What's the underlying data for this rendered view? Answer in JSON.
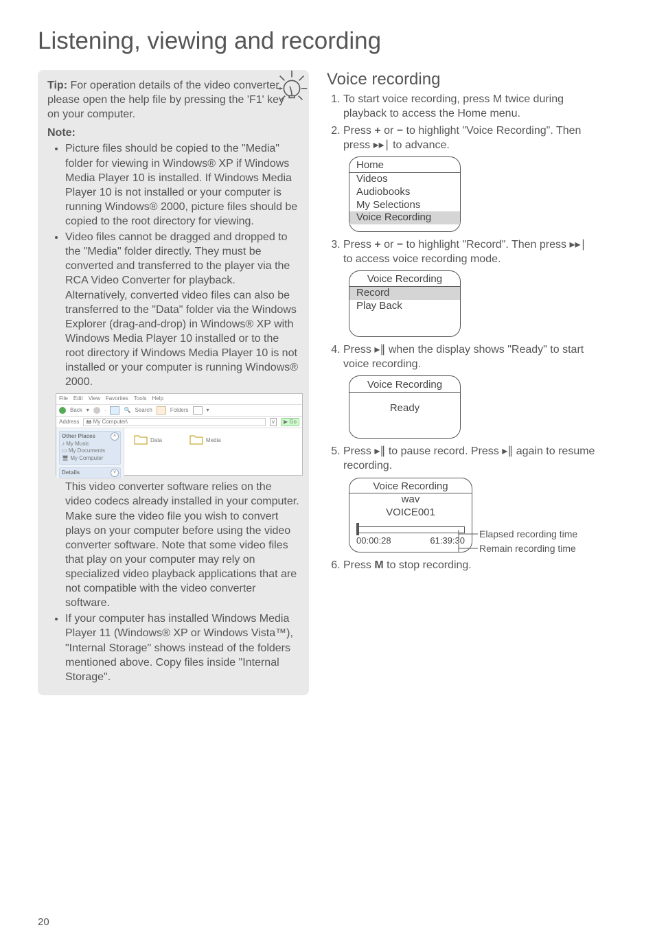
{
  "page_title": "Listening, viewing and recording",
  "tip": {
    "label": "Tip:",
    "text": " For operation details of the video converter, please open the help file by pressing the 'F1' key on your computer."
  },
  "note_label": "Note:",
  "notes": {
    "b1": "Picture files should be copied to the \"Media\" folder for viewing in Windows® XP if Windows Media Player 10 is installed. If Windows Media Player 10 is not installed or your computer is running Windows® 2000, picture files should be copied to the root directory for viewing.",
    "b2": "Video files cannot be dragged and dropped to the \"Media\" folder directly. They must be converted and transferred to the player via the RCA Video Converter for playback. Alternatively, converted video files can also be transferred  to the \"Data\" folder via the Windows Explorer (drag-and-drop) in Windows® XP with Windows Media Player 10 installed or to the root directory if Windows Media Player 10 is not installed or your computer is running Windows® 2000.",
    "after_screenshot": "This video converter software relies on the video codecs already installed in your computer.  Make sure the video file you wish to convert plays on your computer before using the video converter software. Note that some video files that play on your computer may rely on specialized video playback applications that are not compatible with the video converter software.",
    "b3": "If your computer has installed Windows Media Player 11 (Windows® XP or Windows Vista™), \"Internal Storage\" shows instead of the folders mentioned above. Copy files inside \"Internal Storage\"."
  },
  "explorer": {
    "menu": {
      "file": "File",
      "edit": "Edit",
      "view": "View",
      "favorites": "Favorites",
      "tools": "Tools",
      "help": "Help"
    },
    "toolbar": {
      "back": "Back",
      "search": "Search",
      "folders": "Folders"
    },
    "address_label": "Address",
    "address_value": "My Computer\\",
    "go": "Go",
    "left": {
      "other_places": "Other Places",
      "my_music": "My Music",
      "my_documents": "My Documents",
      "my_computer": "My Computer",
      "details": "Details"
    },
    "right": {
      "data": "Data",
      "media": "Media"
    }
  },
  "voice_section_title": "Voice recording",
  "steps": {
    "s1": "To start voice recording, press M twice during playback to access the Home menu.",
    "s2a": "Press ",
    "s2b": " or ",
    "s2c": " to highlight \"Voice Recording\". Then press ",
    "s2d": " to advance.",
    "s3a": "Press ",
    "s3b": " or ",
    "s3c": " to highlight \"Record\". Then press ",
    "s3d": " to access voice recording mode.",
    "s4a": "Press ",
    "s4b": " when the display shows \"Ready\" to start voice recording.",
    "s5a": "Press ",
    "s5b": " to pause record. Press ",
    "s5c": " again to resume recording.",
    "s6a": "Press ",
    "s6M": "M",
    "s6b": " to stop recording."
  },
  "glyphs": {
    "plus": "+",
    "minus": "−",
    "next": "▸▸∣",
    "playpause": "▸∥"
  },
  "device_home": {
    "title": "Home",
    "items": {
      "videos": "Videos",
      "audiobooks": "Audiobooks",
      "mysel": "My Selections",
      "vr": "Voice Recording"
    }
  },
  "device_vr_menu": {
    "title": "Voice Recording",
    "items": {
      "record": "Record",
      "playback": "Play Back"
    }
  },
  "device_ready": {
    "title": "Voice Recording",
    "status": "Ready"
  },
  "device_rec": {
    "title": "Voice Recording",
    "fileext": "wav",
    "filename": "VOICE001",
    "elapsed": "00:00:28",
    "remain": "61:39:30"
  },
  "annot": {
    "elapsed": "Elapsed recording time",
    "remain": "Remain recording time"
  },
  "page_number": "20"
}
